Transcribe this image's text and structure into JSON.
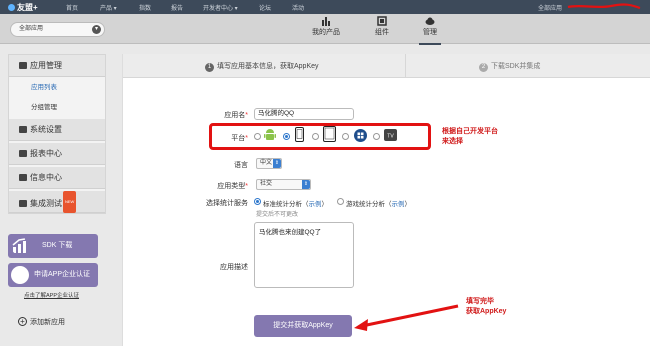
{
  "topnav": {
    "logo": "友盟+",
    "items": [
      "首页",
      "产品",
      "指数",
      "报告",
      "开发者中心",
      "论坛",
      "活动"
    ],
    "right": "全部应用"
  },
  "subheader": {
    "app_select": "全部应用",
    "tabs": [
      {
        "label": "我的产品",
        "icon": "bar-chart-icon"
      },
      {
        "label": "组件",
        "icon": "component-icon"
      },
      {
        "label": "管理",
        "icon": "cloud-icon",
        "active": true
      }
    ]
  },
  "sidebar": {
    "app_management": "应用管理",
    "app_list": "应用列表",
    "group_management": "分组管理",
    "system_settings": "系统设置",
    "report_center": "报表中心",
    "message_center": "信息中心",
    "integration_test": "集成测试",
    "new_badge": "NEW",
    "sdk_download": "SDK 下载",
    "enterprise_apply": "申请APP企业认证",
    "enterprise_link": "点击了解APP企业认证",
    "add_app": "添加新应用"
  },
  "steps": {
    "step1_num": "1",
    "step1": "填写应用基本信息，获取AppKey",
    "step2_num": "2",
    "step2": "下载SDK并集成"
  },
  "form": {
    "app_name_label": "应用名",
    "app_name_value": "马化腾的QQ",
    "platform_label": "平台",
    "language_label": "语言",
    "language_value": "中文",
    "app_type_label": "应用类型",
    "app_type_value": "社交",
    "stats_service_label": "选择统计服务",
    "stats_standard": "标准统计分析",
    "stats_game": "游戏统计分析",
    "example": "示例",
    "stats_hint": "提交后不可更改",
    "description_label": "应用描述",
    "description_value": "马化腾也来创建QQ了",
    "required_mark": "*",
    "submit": "提交并获取AppKey"
  },
  "annotations": {
    "platform_note_line1": "根据自己开发平台",
    "platform_note_line2": "来选择",
    "submit_note_line1": "填写完毕",
    "submit_note_line2": "获取AppKey"
  },
  "colors": {
    "nav_bg": "#3d4a5a",
    "accent_purple": "#8478b0",
    "annotation_red": "#e21212",
    "link_blue": "#2a6bb5"
  }
}
